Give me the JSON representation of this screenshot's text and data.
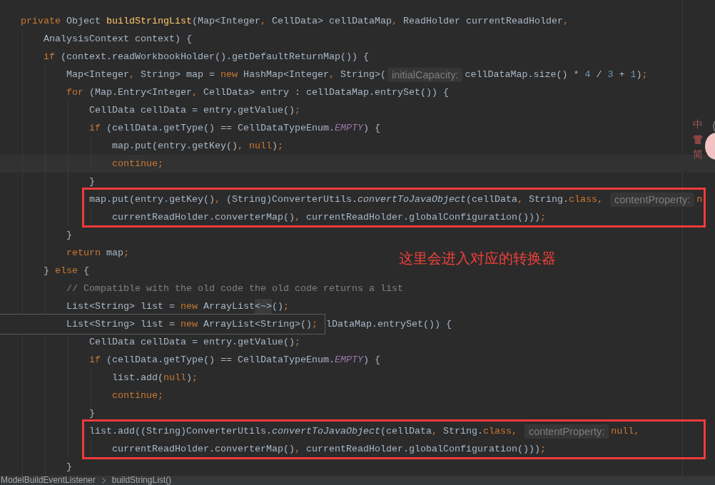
{
  "editor": {
    "lines": [
      {
        "kind": "line",
        "segments": [
          {
            "text": "private",
            "kind": "keyword"
          },
          {
            "text": " Object ",
            "kind": "plain"
          },
          {
            "text": "buildStringList",
            "kind": "declaration"
          },
          {
            "text": "(Map<Integer",
            "kind": "plain"
          },
          {
            "text": ",",
            "kind": "keyword"
          },
          {
            "text": " CellData> cellDataMap",
            "kind": "plain"
          },
          {
            "text": ",",
            "kind": "keyword"
          },
          {
            "text": " ReadHolder currentReadHolder",
            "kind": "plain"
          },
          {
            "text": ",",
            "kind": "keyword"
          }
        ],
        "children": [
          {
            "kind": "line",
            "segments": [
              {
                "text": "AnalysisContext context) {",
                "kind": "plain"
              }
            ]
          },
          {
            "kind": "line",
            "segments": [
              {
                "text": "if",
                "kind": "keyword"
              },
              {
                "text": " (context.readWorkbookHolder().getDefaultReturnMap()) {",
                "kind": "plain"
              }
            ],
            "children": [
              {
                "kind": "line",
                "segments": [
                  {
                    "text": "Map<Integer",
                    "kind": "plain"
                  },
                  {
                    "text": ",",
                    "kind": "keyword"
                  },
                  {
                    "text": " String> map = ",
                    "kind": "plain"
                  },
                  {
                    "text": "new",
                    "kind": "keyword"
                  },
                  {
                    "text": " HashMap<Integer",
                    "kind": "plain"
                  },
                  {
                    "text": ",",
                    "kind": "keyword"
                  },
                  {
                    "text": " String>(",
                    "kind": "plain"
                  },
                  {
                    "text": "initialCapacity:",
                    "kind": "hint"
                  },
                  {
                    "text": "cellDataMap.size() * ",
                    "kind": "plain"
                  },
                  {
                    "text": "4",
                    "kind": "number"
                  },
                  {
                    "text": " / ",
                    "kind": "plain"
                  },
                  {
                    "text": "3",
                    "kind": "number"
                  },
                  {
                    "text": " + ",
                    "kind": "plain"
                  },
                  {
                    "text": "1",
                    "kind": "number"
                  },
                  {
                    "text": ")",
                    "kind": "plain"
                  },
                  {
                    "text": ";",
                    "kind": "keyword"
                  }
                ]
              },
              {
                "kind": "line",
                "segments": [
                  {
                    "text": "for",
                    "kind": "keyword"
                  },
                  {
                    "text": " (Map.Entry<Integer",
                    "kind": "plain"
                  },
                  {
                    "text": ",",
                    "kind": "keyword"
                  },
                  {
                    "text": " CellData> entry : cellDataMap.entrySet()) {",
                    "kind": "plain"
                  }
                ],
                "children": [
                  {
                    "kind": "line",
                    "segments": [
                      {
                        "text": "CellData cellData = entry.getValue()",
                        "kind": "plain"
                      },
                      {
                        "text": ";",
                        "kind": "keyword"
                      }
                    ]
                  },
                  {
                    "kind": "line",
                    "segments": [
                      {
                        "text": "if",
                        "kind": "keyword"
                      },
                      {
                        "text": " (cellData.getType() == CellDataTypeEnum.",
                        "kind": "plain"
                      },
                      {
                        "text": "EMPTY",
                        "kind": "constant"
                      },
                      {
                        "text": ") {",
                        "kind": "plain"
                      }
                    ],
                    "children": [
                      {
                        "kind": "line",
                        "segments": [
                          {
                            "text": "map.put(entry.getKey()",
                            "kind": "plain"
                          },
                          {
                            "text": ", null",
                            "kind": "keyword"
                          },
                          {
                            "text": ")",
                            "kind": "plain"
                          },
                          {
                            "text": ";",
                            "kind": "keyword"
                          }
                        ]
                      },
                      {
                        "kind": "caret_line",
                        "segments": [
                          {
                            "text": "continue;",
                            "kind": "keyword"
                          }
                        ]
                      }
                    ]
                  },
                  {
                    "kind": "line",
                    "segments": [
                      {
                        "text": "}",
                        "kind": "plain"
                      }
                    ]
                  },
                  {
                    "kind": "boxed",
                    "segments": [
                      {
                        "text": "map.put(entry.getKey()",
                        "kind": "plain"
                      },
                      {
                        "text": ", ",
                        "kind": "keyword"
                      },
                      {
                        "text": "(String)ConverterUtils.",
                        "kind": "plain"
                      },
                      {
                        "text": "convertToJavaObject",
                        "kind": "static"
                      },
                      {
                        "text": "(cellData",
                        "kind": "plain"
                      },
                      {
                        "text": ", ",
                        "kind": "keyword"
                      },
                      {
                        "text": "String.",
                        "kind": "plain"
                      },
                      {
                        "text": "class, ",
                        "kind": "keyword"
                      },
                      {
                        "text": "contentProperty:",
                        "kind": "hint"
                      },
                      {
                        "text": "n",
                        "kind": "keyword"
                      }
                    ],
                    "children": [
                      {
                        "kind": "line",
                        "segments": [
                          {
                            "text": "currentReadHolder.converterMap()",
                            "kind": "plain"
                          },
                          {
                            "text": ", ",
                            "kind": "keyword"
                          },
                          {
                            "text": "currentReadHolder.globalConfiguration()))",
                            "kind": "plain"
                          },
                          {
                            "text": ";",
                            "kind": "keyword"
                          }
                        ]
                      }
                    ]
                  }
                ]
              },
              {
                "kind": "line",
                "segments": [
                  {
                    "text": "}",
                    "kind": "plain"
                  }
                ]
              },
              {
                "kind": "line",
                "segments": [
                  {
                    "text": "return",
                    "kind": "keyword"
                  },
                  {
                    "text": " map",
                    "kind": "plain"
                  },
                  {
                    "text": ";",
                    "kind": "keyword"
                  }
                ]
              }
            ]
          },
          {
            "kind": "line",
            "segments": [
              {
                "text": "} ",
                "kind": "plain"
              },
              {
                "text": "else",
                "kind": "keyword"
              },
              {
                "text": " {",
                "kind": "plain"
              }
            ],
            "children": [
              {
                "kind": "line",
                "segments": [
                  {
                    "text": "// Compatible with the old code the old code returns a list",
                    "kind": "comment"
                  }
                ]
              },
              {
                "kind": "line",
                "segments": [
                  {
                    "text": "List<String> list = ",
                    "kind": "plain"
                  },
                  {
                    "text": "new",
                    "kind": "keyword"
                  },
                  {
                    "text": " ArrayList",
                    "kind": "plain"
                  },
                  {
                    "text": "<~>",
                    "kind": "fold"
                  },
                  {
                    "text": "()",
                    "kind": "plain"
                  },
                  {
                    "text": ";",
                    "kind": "keyword"
                  }
                ]
              },
              {
                "kind": "popup",
                "popup": [
                  {
                    "text": "List<String> list = ",
                    "kind": "plain"
                  },
                  {
                    "text": "new",
                    "kind": "keyword"
                  },
                  {
                    "text": " ArrayList<String>()",
                    "kind": "plain"
                  },
                  {
                    "text": ";",
                    "kind": "keyword"
                  }
                ],
                "segments": [
                  {
                    "text": "lDataMap.entrySet()) {",
                    "kind": "plain"
                  }
                ],
                "children": [
                  {
                    "kind": "line",
                    "segments": [
                      {
                        "text": "CellData cellData = entry.getValue()",
                        "kind": "plain"
                      },
                      {
                        "text": ";",
                        "kind": "keyword"
                      }
                    ]
                  },
                  {
                    "kind": "line",
                    "segments": [
                      {
                        "text": "if",
                        "kind": "keyword"
                      },
                      {
                        "text": " (cellData.getType() == CellDataTypeEnum.",
                        "kind": "plain"
                      },
                      {
                        "text": "EMPTY",
                        "kind": "constant"
                      },
                      {
                        "text": ") {",
                        "kind": "plain"
                      }
                    ],
                    "children": [
                      {
                        "kind": "line",
                        "segments": [
                          {
                            "text": "list.add(",
                            "kind": "plain"
                          },
                          {
                            "text": "null",
                            "kind": "keyword"
                          },
                          {
                            "text": ")",
                            "kind": "plain"
                          },
                          {
                            "text": ";",
                            "kind": "keyword"
                          }
                        ]
                      },
                      {
                        "kind": "line",
                        "segments": [
                          {
                            "text": "continue;",
                            "kind": "keyword"
                          }
                        ]
                      }
                    ]
                  },
                  {
                    "kind": "line",
                    "segments": [
                      {
                        "text": "}",
                        "kind": "plain"
                      }
                    ]
                  },
                  {
                    "kind": "boxed",
                    "segments": [
                      {
                        "text": "list.add((String)ConverterUtils.",
                        "kind": "plain"
                      },
                      {
                        "text": "convertToJavaObject",
                        "kind": "static"
                      },
                      {
                        "text": "(cellData",
                        "kind": "plain"
                      },
                      {
                        "text": ", ",
                        "kind": "keyword"
                      },
                      {
                        "text": "String.",
                        "kind": "plain"
                      },
                      {
                        "text": "class, ",
                        "kind": "keyword"
                      },
                      {
                        "text": "contentProperty:",
                        "kind": "hint"
                      },
                      {
                        "text": "null,",
                        "kind": "keyword"
                      }
                    ],
                    "children": [
                      {
                        "kind": "line",
                        "segments": [
                          {
                            "text": "currentReadHolder.converterMap()",
                            "kind": "plain"
                          },
                          {
                            "text": ", ",
                            "kind": "keyword"
                          },
                          {
                            "text": "currentReadHolder.globalConfiguration()))",
                            "kind": "plain"
                          },
                          {
                            "text": ";",
                            "kind": "keyword"
                          }
                        ]
                      }
                    ]
                  }
                ]
              },
              {
                "kind": "line",
                "segments": [
                  {
                    "text": "}",
                    "kind": "plain"
                  }
                ]
              }
            ]
          }
        ]
      }
    ],
    "annotation": "这里会进入对应的转换器"
  },
  "ime_toolbar": {
    "mode": "中",
    "script": "简"
  },
  "breadcrumbs": [
    {
      "label": "ModelBuildEventListener"
    },
    {
      "label": "buildStringList()"
    }
  ]
}
